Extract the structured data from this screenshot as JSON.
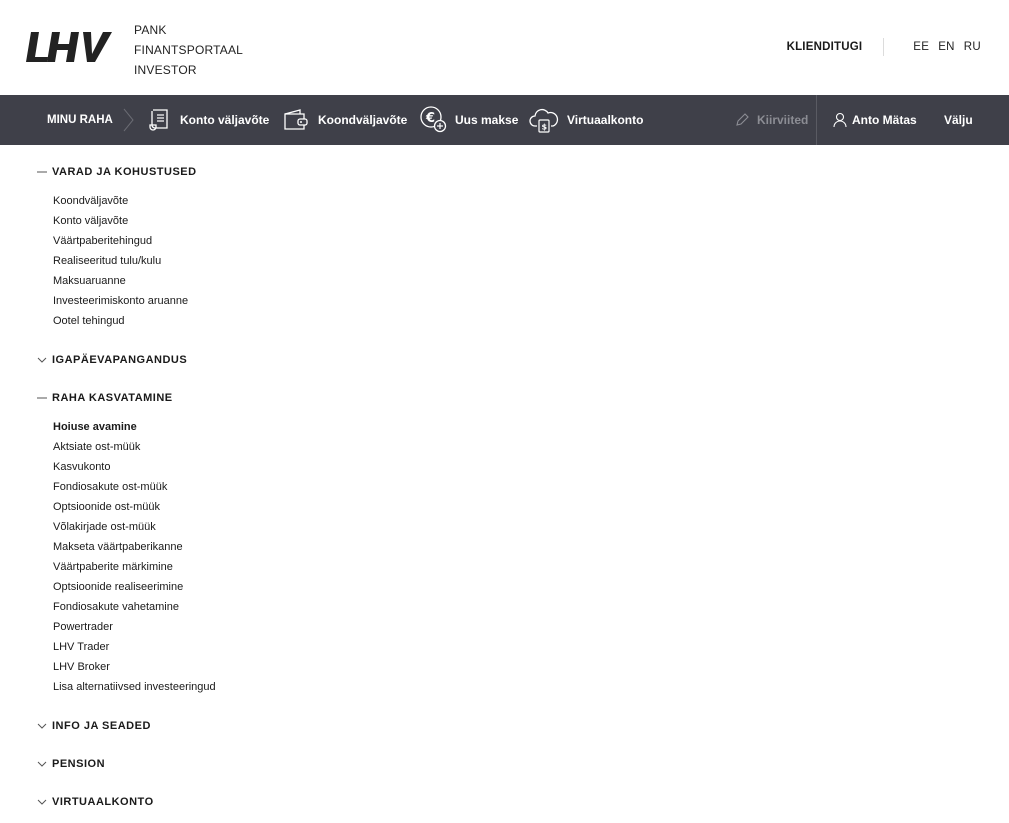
{
  "header": {
    "logo_text": "LHV",
    "portal_links": [
      "PANK",
      "FINANTSPORTAAL",
      "INVESTOR"
    ],
    "support_label": "KLIENDITUGI",
    "languages": [
      "EE",
      "EN",
      "RU"
    ]
  },
  "navbar": {
    "home_label": "MINU RAHA",
    "items": [
      {
        "label": "Konto väljavõte",
        "icon": "statement-icon"
      },
      {
        "label": "Koondväljavõte",
        "icon": "wallet-icon"
      },
      {
        "label": "Uus makse",
        "icon": "euro-plus-icon"
      },
      {
        "label": "Virtuaalkonto",
        "icon": "cloud-money-icon"
      }
    ],
    "quicklinks_label": "Kiirviited",
    "user_name": "Anto Mätas",
    "logout_label": "Välju"
  },
  "menu": {
    "sections": [
      {
        "title": "VARAD JA KOHUSTUSED",
        "expanded": true,
        "items": [
          "Koondväljavõte",
          "Konto väljavõte",
          "Väärtpaberitehingud",
          "Realiseeritud tulu/kulu",
          "Maksuaruanne",
          "Investeerimiskonto aruanne",
          "Ootel tehingud"
        ]
      },
      {
        "title": "IGAPÄEVAPANGANDUS",
        "expanded": false,
        "items": []
      },
      {
        "title": "RAHA KASVATAMINE",
        "expanded": true,
        "items": [
          "Hoiuse avamine",
          "Aktsiate ost-müük",
          "Kasvukonto",
          "Fondiosakute ost-müük",
          "Optsioonide ost-müük",
          "Võlakirjade ost-müük",
          "Makseta väärtpaberikanne",
          "Väärtpaberite märkimine",
          "Optsioonide realiseerimine",
          "Fondiosakute vahetamine",
          "Powertrader",
          "LHV Trader",
          "LHV Broker",
          "Lisa alternatiivsed investeeringud"
        ]
      },
      {
        "title": "INFO JA SEADED",
        "expanded": false,
        "items": []
      },
      {
        "title": "PENSION",
        "expanded": false,
        "items": []
      },
      {
        "title": "VIRTUAALKONTO",
        "expanded": false,
        "items": []
      }
    ]
  },
  "colors": {
    "navbar_bg": "#3f4049",
    "text": "#1a1a1a",
    "disabled": "#8c8d94"
  }
}
